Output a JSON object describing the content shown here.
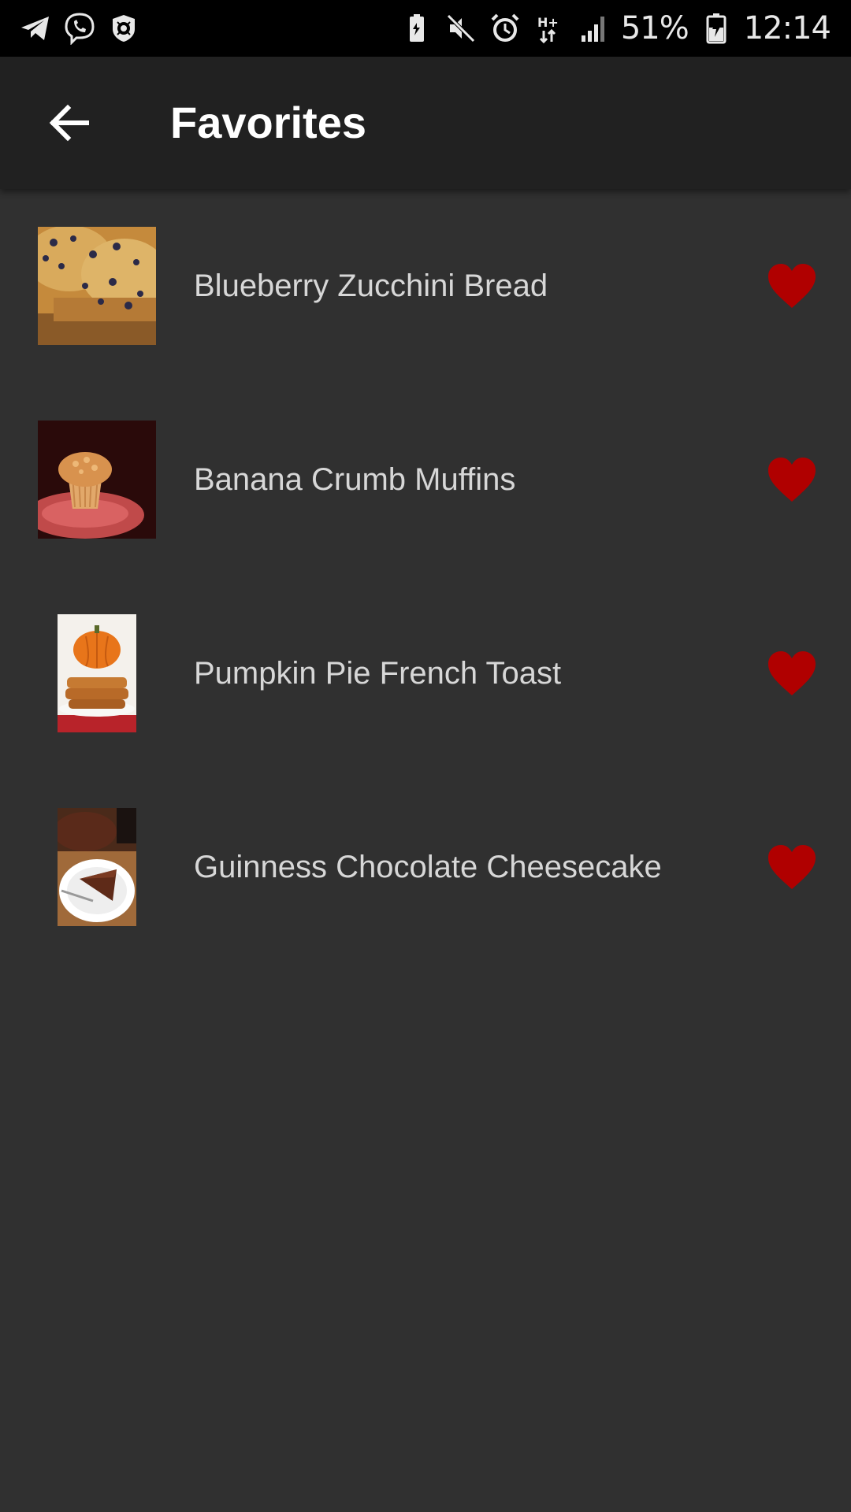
{
  "status_bar": {
    "left_icons": [
      "telegram-icon",
      "viber-icon",
      "dr-web-icon"
    ],
    "right_icons": [
      "battery-saver-icon",
      "mute-icon",
      "alarm-icon",
      "network-h-plus-icon",
      "signal-icon",
      "battery-charging-icon"
    ],
    "network_label": "H+",
    "battery_percent": "51%",
    "time": "12:14"
  },
  "app_bar": {
    "back_icon": "arrow-back-icon",
    "title": "Favorites"
  },
  "favorites": [
    {
      "title": "Blueberry Zucchini Bread",
      "favorited": true,
      "thumb": "blueberry-zucchini-bread-photo"
    },
    {
      "title": "Banana Crumb Muffins",
      "favorited": true,
      "thumb": "banana-crumb-muffins-photo"
    },
    {
      "title": "Pumpkin Pie French Toast",
      "favorited": true,
      "thumb": "pumpkin-pie-french-toast-photo"
    },
    {
      "title": "Guinness Chocolate Cheesecake",
      "favorited": true,
      "thumb": "guinness-chocolate-cheesecake-photo"
    }
  ],
  "colors": {
    "background": "#303030",
    "app_bar": "#212121",
    "status_bar": "#000000",
    "heart": "#b00000",
    "item_text": "#d7d7d7",
    "title_text": "#ffffff"
  }
}
